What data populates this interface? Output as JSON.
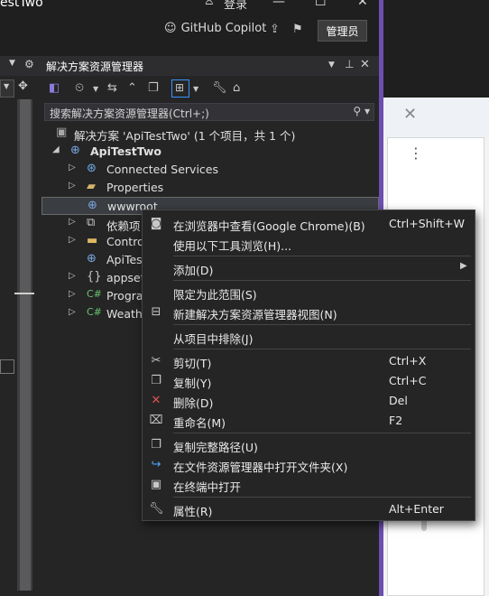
{
  "titlebar": {
    "window_title": "estTwo",
    "login": "登录",
    "copilot": "GitHub Copilot",
    "admin": "管理员"
  },
  "solution_explorer": {
    "title": "解决方案资源管理器",
    "search_placeholder": "搜索解决方案资源管理器(Ctrl+;)",
    "tree": [
      {
        "label": "解决方案 'ApiTestTwo' (1 个项目，共 1 个)",
        "icon": "solution-icon"
      },
      {
        "label": "ApiTestTwo",
        "icon": "web-project-icon"
      },
      {
        "label": "Connected Services",
        "icon": "connected-services-icon"
      },
      {
        "label": "Properties",
        "icon": "properties-folder-icon"
      },
      {
        "label": "wwwroot",
        "icon": "globe-icon"
      },
      {
        "label": "依赖项",
        "icon": "dependencies-icon"
      },
      {
        "label": "Contro",
        "icon": "folder-icon"
      },
      {
        "label": "ApiTes",
        "icon": "web-file-icon"
      },
      {
        "label": "appset",
        "icon": "json-file-icon"
      },
      {
        "label": "Progra",
        "icon": "csharp-file-icon"
      },
      {
        "label": "Weathe",
        "icon": "csharp-file-icon"
      }
    ]
  },
  "context_menu": {
    "items": [
      {
        "label": "在浏览器中查看(Google Chrome)(B)",
        "shortcut": "Ctrl+Shift+W",
        "icon": "browser-view-icon"
      },
      {
        "label": "使用以下工具浏览(H)...",
        "shortcut": "",
        "icon": ""
      },
      {
        "label": "添加(D)",
        "shortcut": "",
        "icon": ""
      },
      {
        "label": "限定为此范围(S)",
        "shortcut": "",
        "icon": ""
      },
      {
        "label": "新建解决方案资源管理器视图(N)",
        "shortcut": "",
        "icon": "new-view-icon"
      },
      {
        "label": "从项目中排除(J)",
        "shortcut": "",
        "icon": ""
      },
      {
        "label": "剪切(T)",
        "shortcut": "Ctrl+X",
        "icon": "cut-icon"
      },
      {
        "label": "复制(Y)",
        "shortcut": "Ctrl+C",
        "icon": "copy-icon"
      },
      {
        "label": "删除(D)",
        "shortcut": "Del",
        "icon": "delete-icon"
      },
      {
        "label": "重命名(M)",
        "shortcut": "F2",
        "icon": "rename-icon"
      },
      {
        "label": "复制完整路径(U)",
        "shortcut": "",
        "icon": "copy-path-icon"
      },
      {
        "label": "在文件资源管理器中打开文件夹(X)",
        "shortcut": "",
        "icon": "open-folder-icon"
      },
      {
        "label": "在终端中打开",
        "shortcut": "",
        "icon": "terminal-icon"
      },
      {
        "label": "属性(R)",
        "shortcut": "Alt+Enter",
        "icon": "wrench-icon"
      }
    ]
  }
}
